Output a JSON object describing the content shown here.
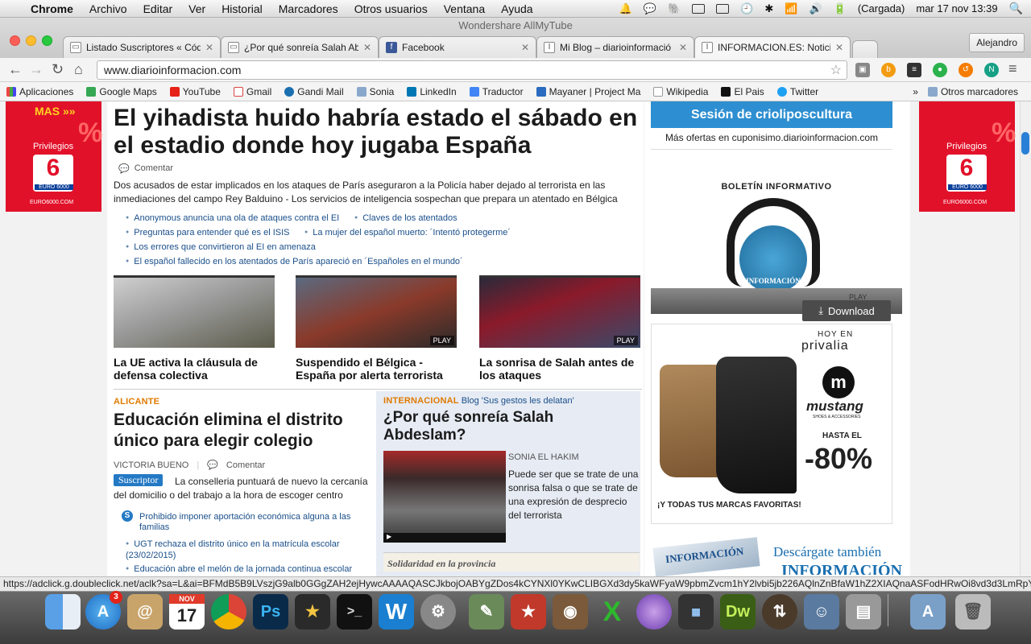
{
  "menubar": {
    "app": "Chrome",
    "items": [
      "Archivo",
      "Editar",
      "Ver",
      "Historial",
      "Marcadores",
      "Otros usuarios",
      "Ventana",
      "Ayuda"
    ],
    "battery": "(Cargada)",
    "clock": "mar 17 nov  13:39"
  },
  "window": {
    "title": "Wondershare AllMyTube"
  },
  "tabs": [
    {
      "label": "Listado Suscriptores « Códi",
      "fav": "▭"
    },
    {
      "label": "¿Por qué sonreía Salah Abd",
      "fav": "▭"
    },
    {
      "label": "Facebook",
      "fav": "f"
    },
    {
      "label": "Mi Blog – diarioinformació",
      "fav": "I"
    },
    {
      "label": "INFORMACION.ES: Noticias",
      "fav": "I"
    }
  ],
  "user": "Alejandro",
  "url": "www.diarioinformacion.com",
  "bookmarks": [
    "Aplicaciones",
    "Google Maps",
    "YouTube",
    "Gmail",
    "Gandi Mail",
    "Sonia",
    "LinkedIn",
    "Traductor",
    "Mayaner | Project Ma",
    "Wikipedia",
    "El Pais",
    "Twitter"
  ],
  "bookmarks_more": "»",
  "bookmarks_other": "Otros marcadores",
  "ad_left": {
    "top": "MAS »»",
    "label": "Privilegios",
    "brand": "EURO 6000",
    "site": "EURO6000.COM"
  },
  "ad_right": {
    "label": "Privilegios",
    "brand": "EURO 6000",
    "site": "EURO6000.COM"
  },
  "headline": "El yihadista huido habría estado el sábado en el estadio donde hoy jugaba España",
  "comment_label": "Comentar",
  "lead": "Dos acusados de estar implicados en los ataques de París aseguraron a la Policía haber dejado al terrorista en las inmediaciones del campo Rey Balduino - Los servicios de inteligencia sospechan que prepara un atentado en Bélgica",
  "related": [
    "Anonymous anuncia una ola de ataques contra el EI",
    "Claves de los atentados",
    "Preguntas para entender qué es el ISIS",
    "La mujer del español muerto: ´Intentó protegerme´",
    "Los errores que convirtieron al EI en amenaza",
    "El español fallecido en los atentados de París apareció en ´Españoles en el mundo´"
  ],
  "thumbs": [
    {
      "caption": "La UE activa la cláusula de defensa colectiva",
      "play": ""
    },
    {
      "caption": "Suspendido el Bélgica - España por alerta terrorista",
      "play": "PLAY"
    },
    {
      "caption": "La sonrisa de Salah antes de los ataques",
      "play": "PLAY"
    }
  ],
  "alicante": {
    "section": "ALICANTE",
    "title": "Educación elimina el distrito único para elegir colegio",
    "author": "VICTORIA BUENO",
    "comment": "Comentar",
    "badge": "Suscriptor",
    "text": "La conselleria puntuará de nuevo la cercanía del domicilio o del trabajo a la hora de escoger centro",
    "links": [
      "Prohibido imponer aportación económica alguna a las familias",
      "UGT rechaza el distrito único en la matrícula escolar (23/02/2015)",
      "Educación abre el melón de la jornada continua escolar"
    ]
  },
  "internacional": {
    "section": "INTERNACIONAL",
    "blog": "Blog 'Sus gestos les delatan'",
    "title": "¿Por qué sonreía Salah Abdeslam?",
    "author": "SONIA EL HAKIM",
    "text": "Puede ser que se trate de una sonrisa falsa o que se trate de una expresión de desprecio del terrorista",
    "solidaridad": "Solidaridad en la provincia"
  },
  "right": {
    "promo_title": "Sesión de crioliposcultura",
    "promo_link": "Más ofertas en cuponisimo.diarioinformacion.com",
    "boletin": "BOLETÍN INFORMATIVO",
    "boletin_brand": "INFORMACIÓN",
    "play": "PLAY",
    "download": "Download",
    "privalia_hoy": "HOY EN",
    "privalia": "privalia",
    "mustang": "mustang",
    "mustang_sub": "SHOES & ACCESSORIES",
    "hasta": "HASTA EL",
    "discount": "-80%",
    "marcas": "¡Y TODAS TUS MARCAS FAVORITAS!",
    "descarga": "Descárgate también",
    "info_logo": "INFORMACIÓN"
  },
  "status_url": "https://adclick.g.doubleclick.net/aclk?sa=L&ai=BFMdB5B9LVszjG9alb0GGgZAH2ejHywcAAAAQASCJkbojOABYgZDos4kCYNXl0YKwCLIBGXd3dy5kaWFyaW9pbmZvcm1hY2lvbi5jb226AQlnZnBfaW1hZ2XIAQnaASFodHRwOi8vd3d3LmRpYXJpbm",
  "dock": {
    "badge": "3",
    "cal_month": "NOV",
    "cal_day": "17"
  },
  "colors": {
    "ad_red": "#e2112a",
    "link_blue": "#1a4f8a",
    "section_orange": "#e07a00",
    "promo_blue": "#2d8fd1"
  }
}
